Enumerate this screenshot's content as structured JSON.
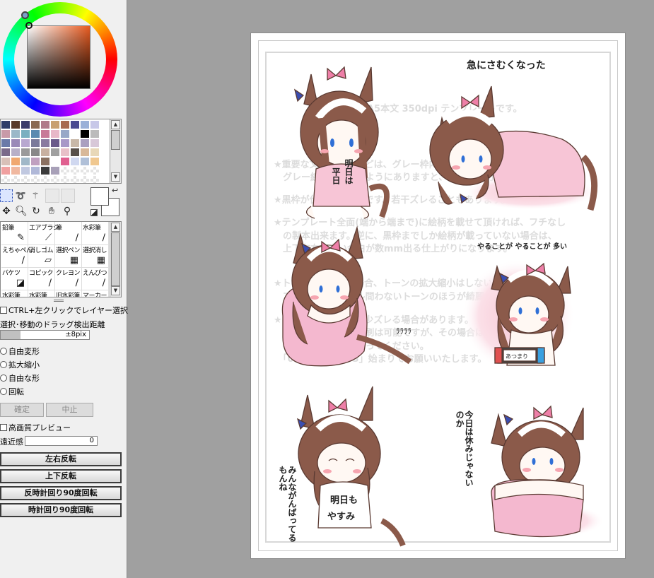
{
  "colors": {
    "hair": "#8b5a4a",
    "hair_white": "#ffffff",
    "shirt": "#f7c5d6",
    "cushion": "#f4b8cf",
    "ribbon": "#ee7fa8",
    "earring": "#3a4db0",
    "outline": "#5a3a32",
    "blush": "#f6a5b0",
    "eye": "#2f6fd6",
    "faint_text": "#dcdcdc"
  },
  "swatches": [
    "#2e3d68",
    "#5a3a2a",
    "#3a3a6a",
    "#8a6a52",
    "#b07a8a",
    "#c8a070",
    "#a86a50",
    "#4a4a90",
    "#9ab0d8",
    "#c8c8e8",
    "#c89aa8",
    "#9ab8c8",
    "#7ab0c0",
    "#5a8ab0",
    "#c87a98",
    "#e8b8c8",
    "#98a8c8",
    "#ffffff",
    "#000000",
    "#bbbbbb",
    "#6a7aa8",
    "#9a8ab8",
    "#b8a8d0",
    "#7a7a9a",
    "#8a7aa0",
    "#6a5a8a",
    "#a898c8",
    "#c8b8a8",
    "#aaa0c0",
    "#d8c8d8",
    "#7a6a8a",
    "#b8b0c8",
    "#9a9a9a",
    "#888888",
    "#c8b0a0",
    "#a0a0a0",
    "#e8c0c8",
    "#58504a",
    "#d8b898",
    "#e8d8b8",
    "#d8c0b8",
    "#f0a870",
    "#a0b8c8",
    "#c0a0c0",
    "#8a7060",
    "#ffffff",
    "#e06090",
    "#d0d8f0",
    "#b0c0d8",
    "#f0c890",
    "#f0a0a0",
    "#f0b8a0",
    "#c0c8e0",
    "#b0b8d8",
    "#3a3a3a",
    "#a8a0b8",
    "",
    "",
    "",
    "",
    "",
    "",
    "",
    "",
    "",
    "",
    "",
    "",
    "",
    "",
    "",
    "",
    "",
    "",
    "",
    "",
    "",
    "",
    "",
    ""
  ],
  "tools": {
    "rect_select": "rect-select-icon",
    "lasso": "lasso-icon",
    "magic_wand": "magic-wand-icon",
    "move": "move-icon",
    "zoom": "zoom-icon",
    "rotate": "rotate-icon",
    "hand": "hand-icon",
    "eyedropper": "eyedropper-icon"
  },
  "brushes": [
    {
      "label": "鉛筆",
      "icon": "✎"
    },
    {
      "label": "エアブラシ",
      "icon": "⟋"
    },
    {
      "label": "筆",
      "icon": "∕"
    },
    {
      "label": "水彩筆",
      "icon": "∕"
    },
    {
      "label": "えちゃぺん",
      "icon": "∕"
    },
    {
      "label": "消しゴム",
      "icon": "▱"
    },
    {
      "label": "選択ペン",
      "icon": "▦"
    },
    {
      "label": "選択消し",
      "icon": "▦"
    },
    {
      "label": "バケツ",
      "icon": "◪"
    },
    {
      "label": "コピック",
      "icon": "∕"
    },
    {
      "label": "クレヨン",
      "icon": "∕"
    },
    {
      "label": "えんぴつ",
      "icon": "∕"
    },
    {
      "label": "水彩筆",
      "icon": ""
    },
    {
      "label": "水彩筆",
      "icon": ""
    },
    {
      "label": "旧水彩筆",
      "icon": ""
    },
    {
      "label": "マーカー",
      "icon": ""
    }
  ],
  "options": {
    "ctrl_click_layer": "CTRL+左クリックでレイヤー選択",
    "drag_detect_label": "選択･移動のドラッグ検出距離",
    "drag_detect_value": "±8pix",
    "radio_free_transform": "自由変形",
    "radio_scale": "拡大縮小",
    "radio_free_shape": "自由な形",
    "radio_rotate": "回転",
    "confirm": "確定",
    "cancel": "中止",
    "hq_preview": "高画質プレビュー",
    "perspective_label": "遠近感",
    "perspective_value": "0",
    "flip_h": "左右反転",
    "flip_v": "上下反転",
    "rotate_ccw": "反時計回り90度回転",
    "rotate_cw": "時計回り90度回転"
  },
  "canvas": {
    "template_text": [
      "これはA5本文 350dpi テンプレートです。",
      "★重要な文字や絵柄などは、グレー枠内より内側に収めてください。",
      "　グレー線を越えないようにありますと、裁断時に切れる場合があります。",
      "★黒枠が仕上がり位置です。若干ズレることもあります。",
      "★テンプレート全面(端から端まで)に絵柄を載せて頂ければ、フチなし",
      "　の製本出来ます。逆に、黒枠までしか絵柄が載っていない場合は、",
      "　上下左右に白い余白が数mm出る仕上がりになります。",
      "★トーンを使用する場合、トーンの拡大縮小はしないでください。",
      "　アナログ・デジタル問わないトーンのほうが綺麗に仕上がります。",
      "★ノンブルは表裏で多少ズレる場合があります。",
      "　ノンブルなしでも印刷は可能ですが、その場合は、ファイル名に",
      "　ページ番号を割り振ってください。",
      "　「01」または「03」始まりでお願いいたします。"
    ],
    "caption_cold": "急にさむくなった",
    "shirt_left": "平日",
    "shirt_right": "明日は",
    "yaru": "やることが  やることが  多い",
    "dots": "ﾗﾗﾗﾗ",
    "screen": "あつまり",
    "minna": "みんながんばってるもんね",
    "ashita_line1": "明日も",
    "ashita_line2": "やすみ",
    "kyou": "今日は休みじゃないのか"
  }
}
